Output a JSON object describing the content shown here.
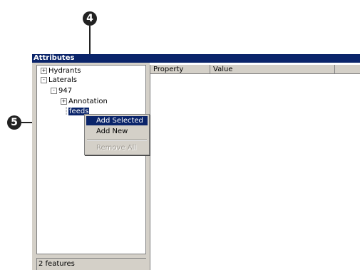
{
  "window": {
    "title": "Attributes"
  },
  "tree": {
    "items": [
      {
        "label": "Hydrants",
        "toggle": "+"
      },
      {
        "label": "Laterals",
        "toggle": "-"
      },
      {
        "label": "947",
        "toggle": "-"
      },
      {
        "label": "Annotation",
        "toggle": "+"
      },
      {
        "label": "feeds",
        "toggle": ""
      }
    ]
  },
  "status": {
    "text": "2 features"
  },
  "table": {
    "columns": [
      "Property",
      "Value"
    ]
  },
  "context_menu": {
    "items": [
      {
        "label": "Add Selected",
        "state": "highlighted"
      },
      {
        "label": "Add New",
        "state": "normal"
      },
      {
        "label": "Remove All",
        "state": "disabled"
      }
    ]
  },
  "callouts": [
    "4",
    "5"
  ],
  "colors": {
    "selection": "#0a246a",
    "face": "#d4d0c8",
    "callout": "#222222"
  }
}
